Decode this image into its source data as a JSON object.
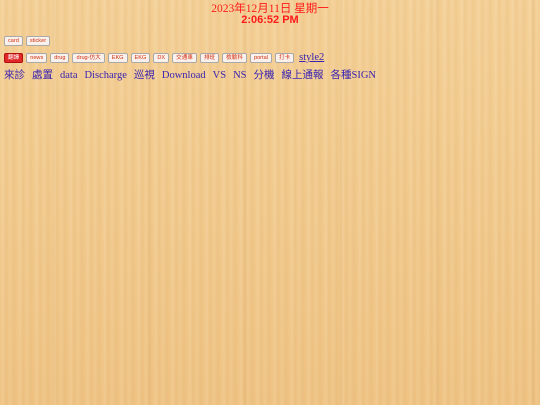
{
  "clock": {
    "date": "2023年12月11日 星期一",
    "time": "2:06:52 PM"
  },
  "row1": [
    "card",
    "sticker"
  ],
  "row2": {
    "chips": [
      "翻譯",
      "news",
      "drug",
      "drug-仿大",
      "EKG",
      "EKG",
      "DX",
      "交通車",
      "排班",
      "檢驗科",
      "portal",
      "打卡"
    ],
    "style_link": "style2"
  },
  "nav": [
    "來診",
    "處置",
    "data",
    "Discharge",
    "巡視",
    "Download",
    "VS",
    "NS",
    "分機",
    "線上通報",
    "各種SIGN"
  ],
  "colors": {
    "clock": "#ff1a1a",
    "link": "#3a23b0",
    "chip_text": "#d03010",
    "chip_red_bg": "#e02a2a",
    "background": "#f1c98a"
  }
}
